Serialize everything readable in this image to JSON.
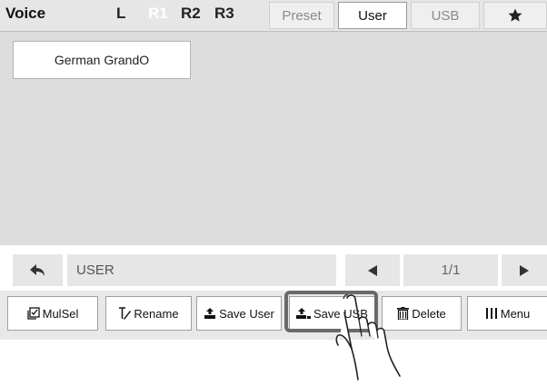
{
  "header": {
    "title": "Voice",
    "parts": [
      {
        "label": "L",
        "active": false
      },
      {
        "label": "R1",
        "active": true
      },
      {
        "label": "R2",
        "active": false
      },
      {
        "label": "R3",
        "active": false
      }
    ],
    "tabs": [
      {
        "label": "Preset"
      },
      {
        "label": "User",
        "selected": true
      },
      {
        "label": "USB"
      },
      {
        "icon": "star-icon"
      }
    ]
  },
  "list": {
    "items": [
      "German GrandO"
    ]
  },
  "nav": {
    "back_icon": "back-arrow-icon",
    "path": "USER",
    "page": "1/1",
    "prev_icon": "triangle-left-icon",
    "next_icon": "triangle-right-icon"
  },
  "functions": {
    "mulsel": "MulSel",
    "rename": "Rename",
    "save_user": "Save User",
    "save_usb": "Save USB",
    "delete": "Delete",
    "menu": "Menu"
  },
  "colors": {
    "bar": "#e6e6e6",
    "content": "#dcdcdc",
    "highlight": "#6a6a6a"
  }
}
